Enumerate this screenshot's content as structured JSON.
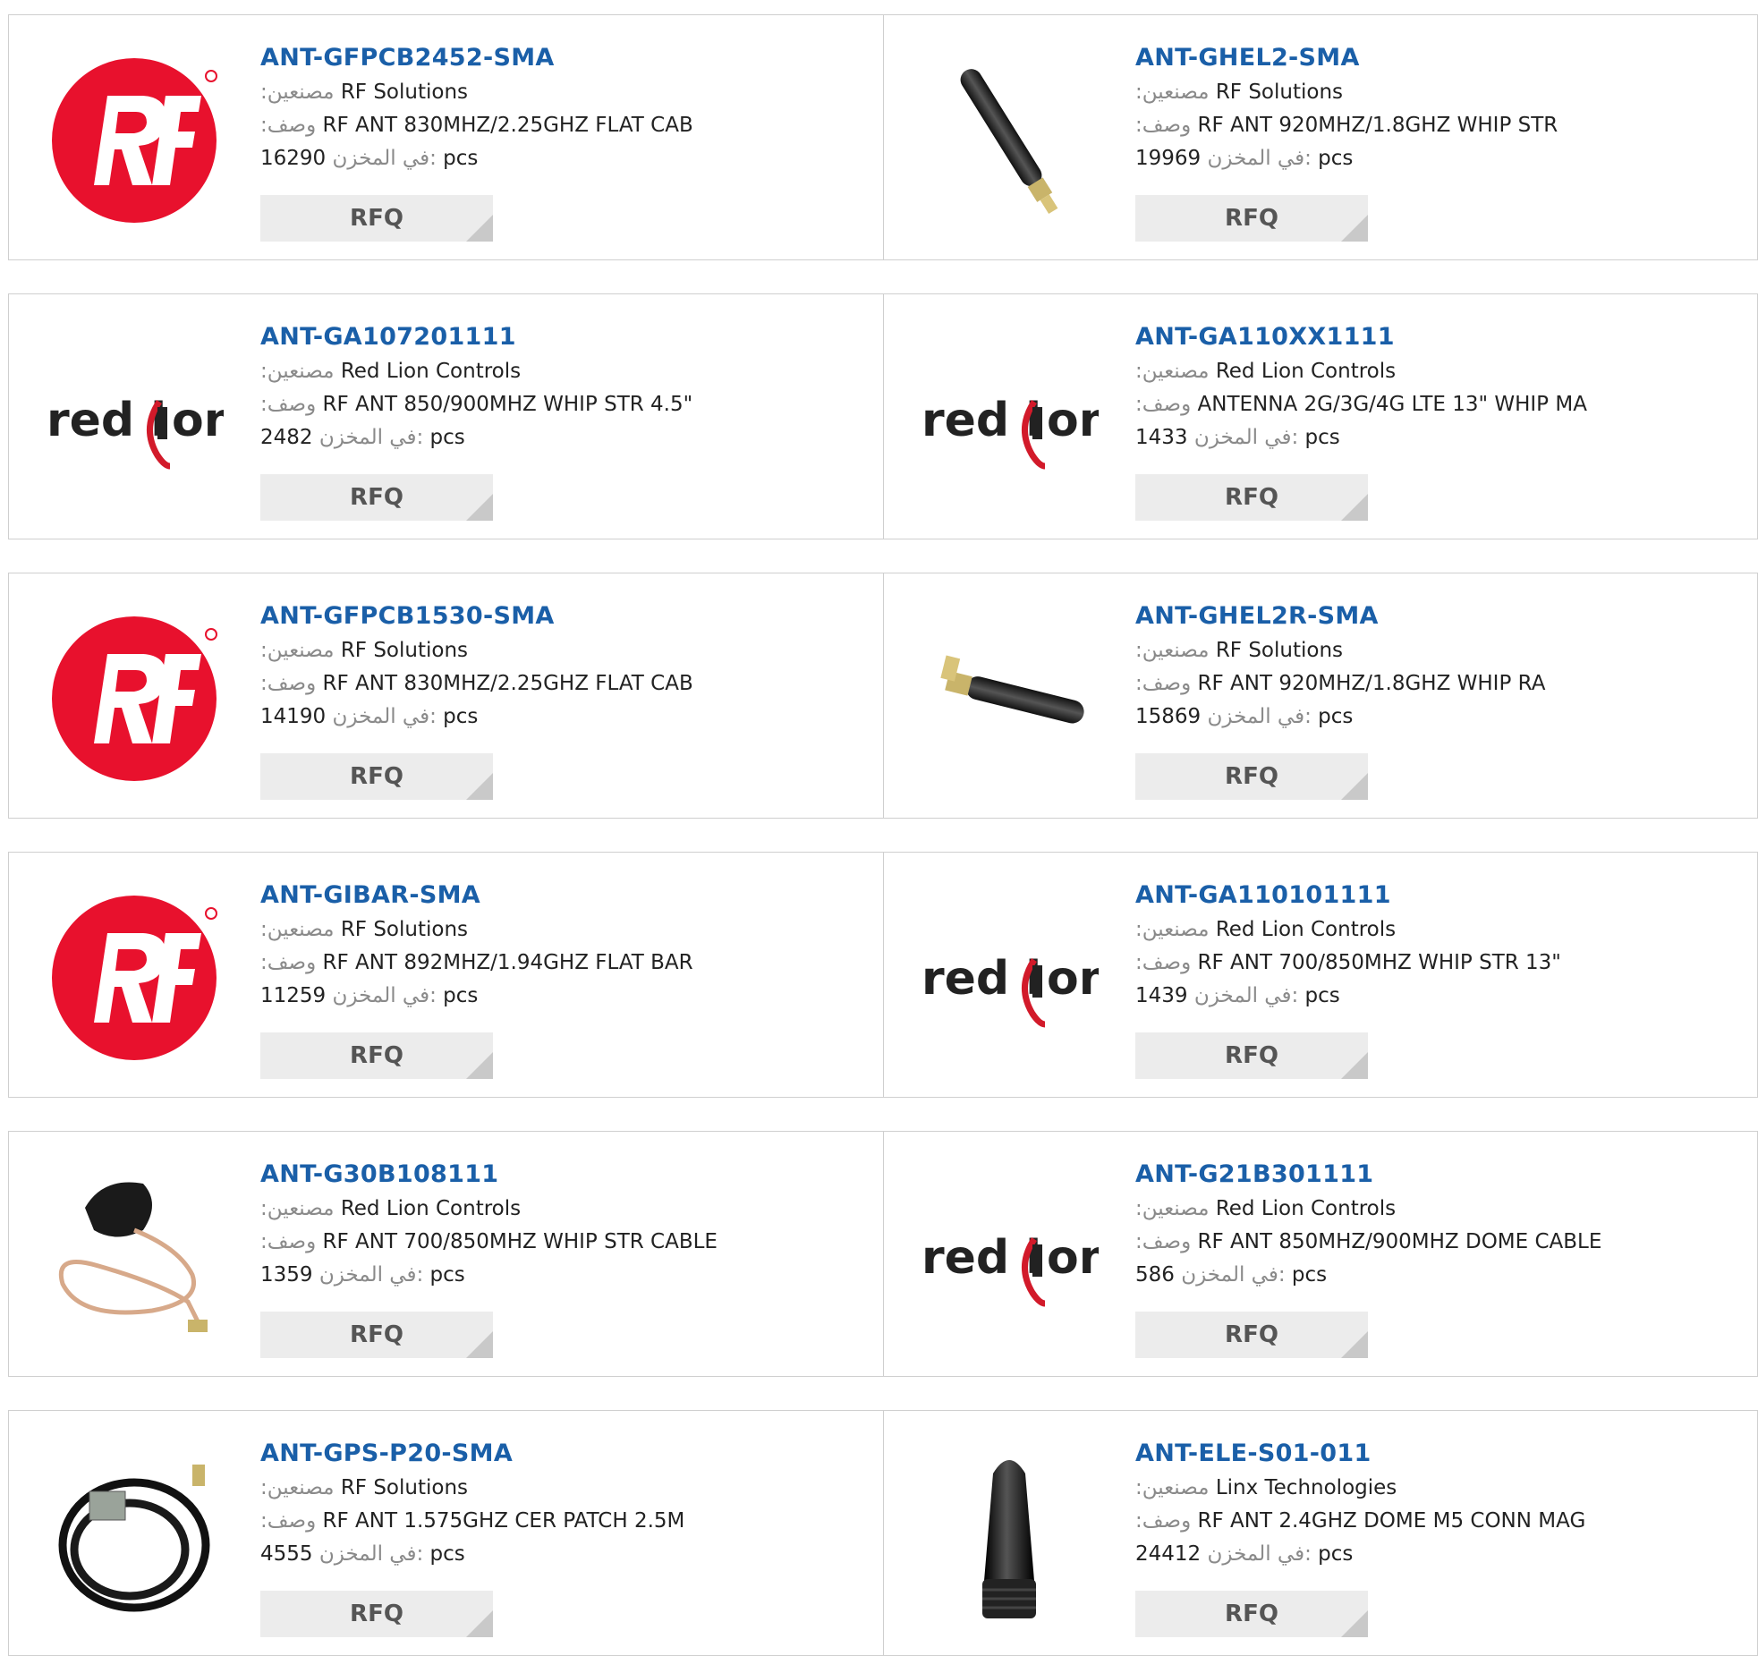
{
  "labels": {
    "manufacturer": ":مصنعين",
    "description": ":وصف",
    "stock": "في المخزن:",
    "unit": "pcs",
    "rfq": "RFQ"
  },
  "logos": {
    "red_lion": "red lion"
  },
  "products": [
    {
      "part": "ANT-GFPCB2452-SMA",
      "manufacturer": "RF Solutions",
      "description": "RF ANT 830MHZ/2.25GHZ FLAT CAB",
      "stock": "16290",
      "image": "rf-solutions-logo"
    },
    {
      "part": "ANT-GHEL2-SMA",
      "manufacturer": "RF Solutions",
      "description": "RF ANT 920MHZ/1.8GHZ WHIP STR",
      "stock": "19969",
      "image": "whip-antenna-straight"
    },
    {
      "part": "ANT-GA107201111",
      "manufacturer": "Red Lion Controls",
      "description": "RF ANT 850/900MHZ WHIP STR 4.5\"",
      "stock": "2482",
      "image": "red-lion-logo"
    },
    {
      "part": "ANT-GA110XX1111",
      "manufacturer": "Red Lion Controls",
      "description": "ANTENNA 2G/3G/4G LTE 13\" WHIP MA",
      "stock": "1433",
      "image": "red-lion-logo"
    },
    {
      "part": "ANT-GFPCB1530-SMA",
      "manufacturer": "RF Solutions",
      "description": "RF ANT 830MHZ/2.25GHZ FLAT CAB",
      "stock": "14190",
      "image": "rf-solutions-logo"
    },
    {
      "part": "ANT-GHEL2R-SMA",
      "manufacturer": "RF Solutions",
      "description": "RF ANT 920MHZ/1.8GHZ WHIP RA",
      "stock": "15869",
      "image": "whip-antenna-right-angle"
    },
    {
      "part": "ANT-GIBAR-SMA",
      "manufacturer": "RF Solutions",
      "description": "RF ANT 892MHZ/1.94GHZ FLAT BAR",
      "stock": "11259",
      "image": "rf-solutions-logo"
    },
    {
      "part": "ANT-GA110101111",
      "manufacturer": "Red Lion Controls",
      "description": "RF ANT 700/850MHZ WHIP STR 13\"",
      "stock": "1439",
      "image": "red-lion-logo"
    },
    {
      "part": "ANT-G30B108111",
      "manufacturer": "Red Lion Controls",
      "description": "RF ANT 700/850MHZ WHIP STR CABLE",
      "stock": "1359",
      "image": "dome-antenna-cable"
    },
    {
      "part": "ANT-G21B301111",
      "manufacturer": "Red Lion Controls",
      "description": "RF ANT 850MHZ/900MHZ DOME CABLE",
      "stock": "586",
      "image": "red-lion-logo"
    },
    {
      "part": "ANT-GPS-P20-SMA",
      "manufacturer": "RF Solutions",
      "description": "RF ANT 1.575GHZ CER PATCH 2.5M",
      "stock": "4555",
      "image": "gps-patch-antenna"
    },
    {
      "part": "ANT-ELE-S01-011",
      "manufacturer": "Linx Technologies",
      "description": "RF ANT 2.4GHZ DOME M5 CONN MAG",
      "stock": "24412",
      "image": "stubby-dome-antenna"
    }
  ],
  "colors": {
    "part_link": "#1a5fa8",
    "label": "#8a8a8a",
    "rfq_bg": "#ececec",
    "rf_red": "#e8112d",
    "border": "#cfcfcf"
  }
}
